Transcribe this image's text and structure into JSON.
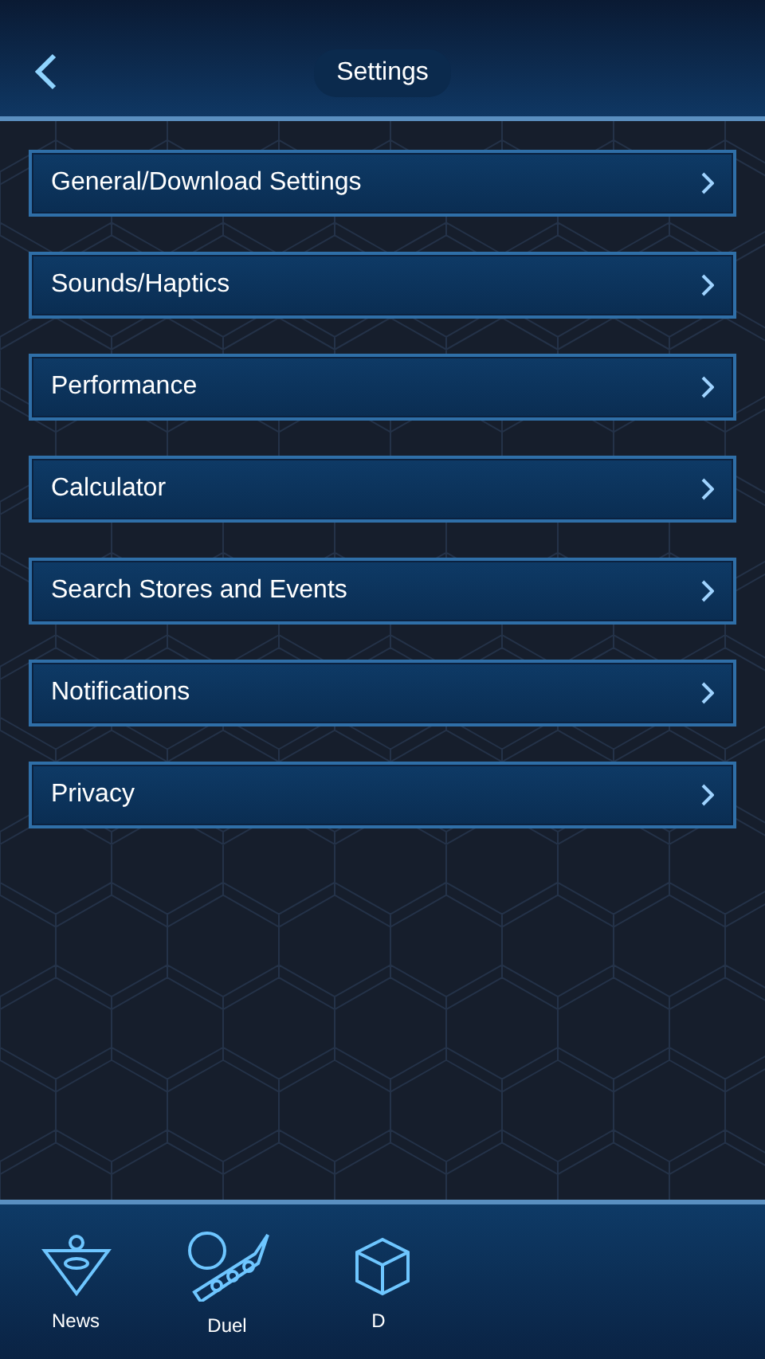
{
  "header": {
    "title": "Settings"
  },
  "menu": [
    {
      "label": "General/Download Settings"
    },
    {
      "label": "Sounds/Haptics"
    },
    {
      "label": "Performance"
    },
    {
      "label": "Calculator"
    },
    {
      "label": "Search Stores and Events"
    },
    {
      "label": "Notifications"
    },
    {
      "label": "Privacy"
    }
  ],
  "nav": [
    {
      "label": "News",
      "kind": "pyramid"
    },
    {
      "label": "Duel",
      "kind": "disk"
    },
    {
      "label": "D",
      "kind": "cube"
    }
  ]
}
